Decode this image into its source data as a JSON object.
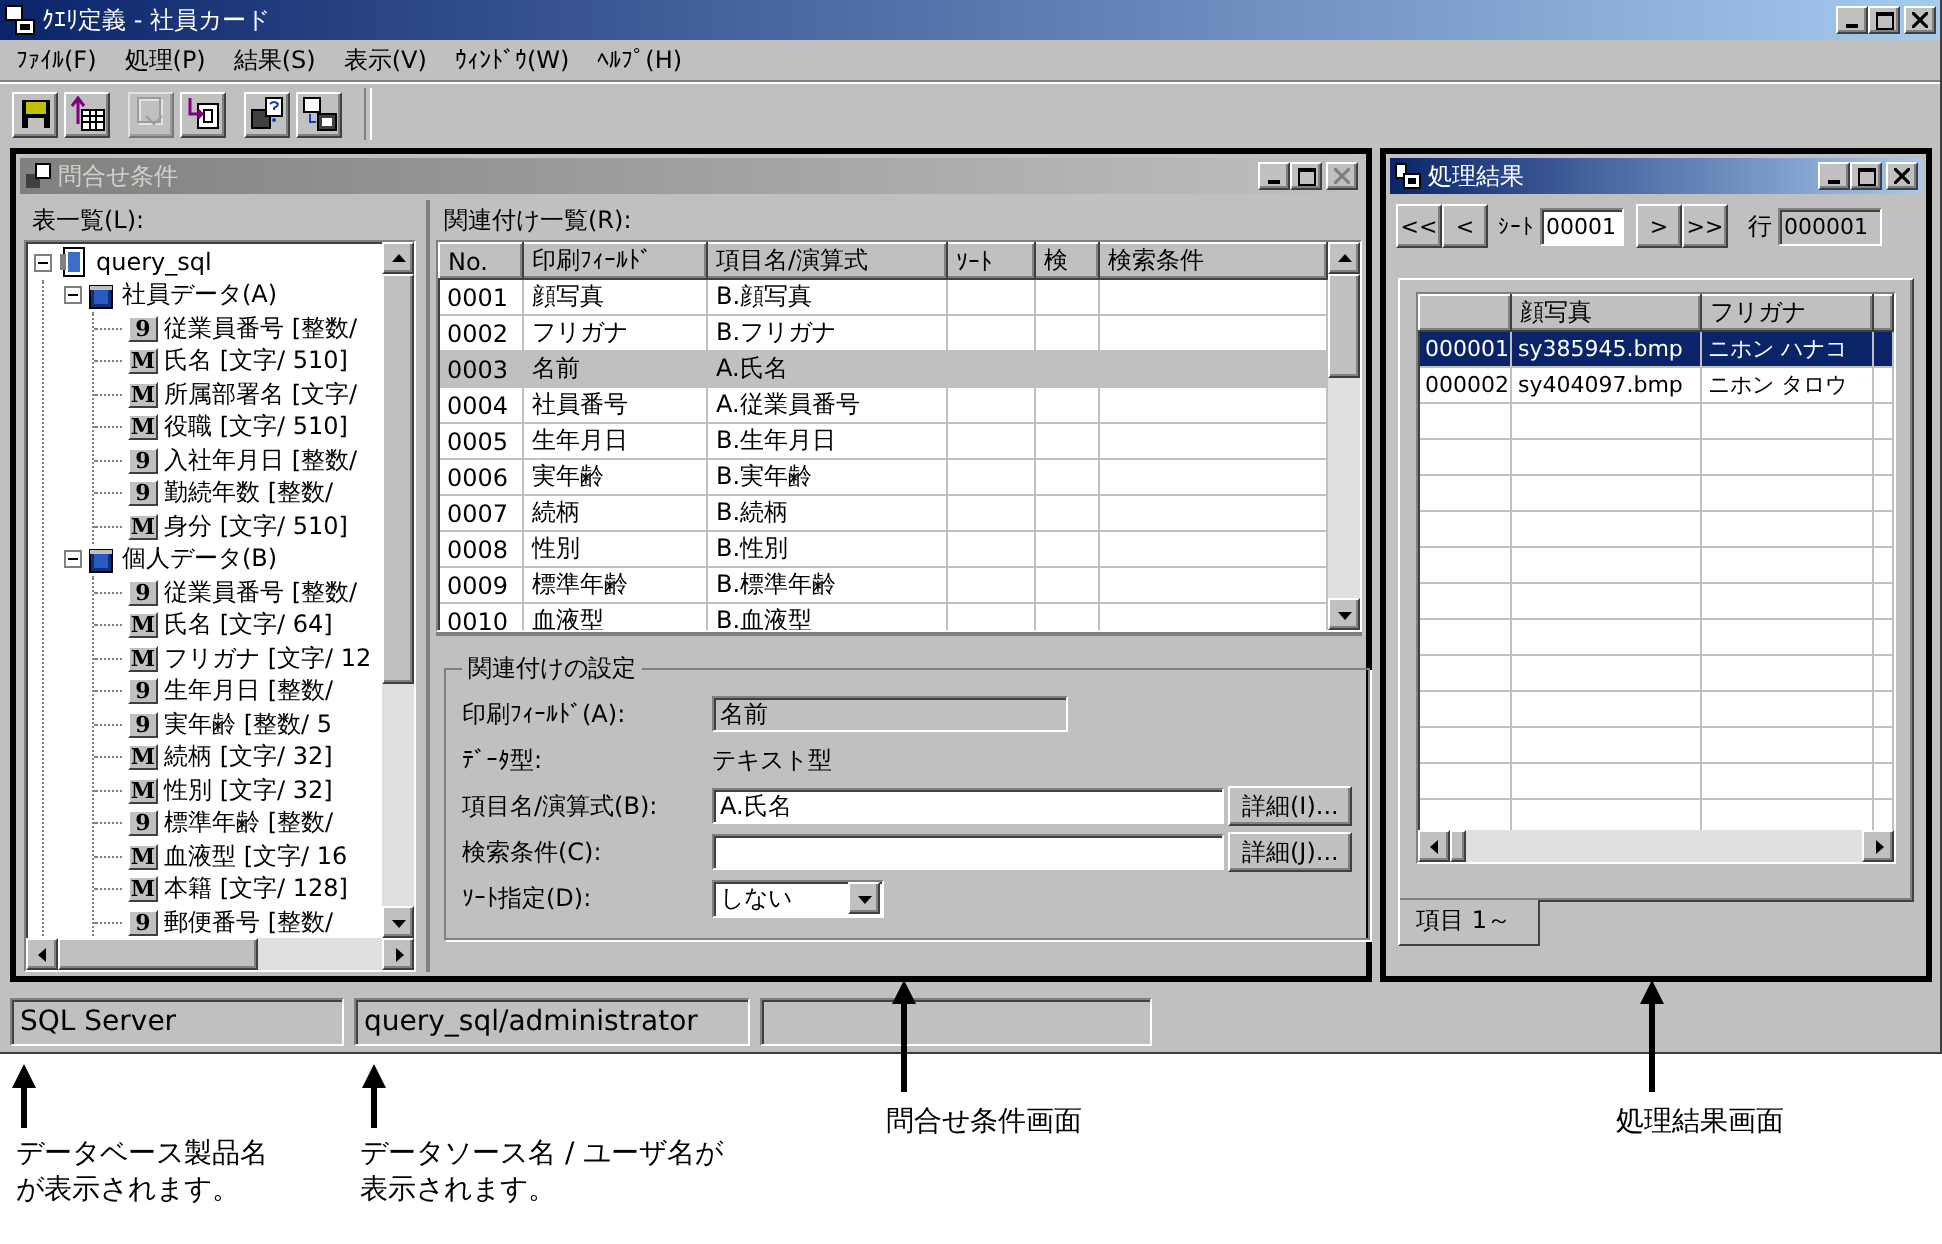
{
  "window": {
    "title": "ｸｴﾘ定義 - 社員カード"
  },
  "menu": [
    {
      "label": "ﾌｧｲﾙ(F)"
    },
    {
      "label": "処理(P)"
    },
    {
      "label": "結果(S)"
    },
    {
      "label": "表示(V)"
    },
    {
      "label": "ｳｨﾝﾄﾞｳ(W)"
    },
    {
      "label": "ﾍﾙﾌﾟ(H)"
    }
  ],
  "toolbar": [
    {
      "kind": "save",
      "disabled": false
    },
    {
      "kind": "table-up",
      "disabled": false
    },
    {
      "kind": "export",
      "disabled": true
    },
    {
      "kind": "insert",
      "disabled": false
    },
    {
      "kind": "query",
      "disabled": false
    },
    {
      "kind": "link",
      "disabled": false
    }
  ],
  "query_window": {
    "title": "問合せ条件",
    "active": false,
    "tables_label": "表一覧(L):",
    "tree": {
      "label": "query_sql",
      "kind": "query",
      "expanded": true,
      "children": [
        {
          "label": "社員データ(A)",
          "kind": "table",
          "expanded": true,
          "children": [
            {
              "label": "従業員番号 [整数/",
              "kind": "field",
              "icon": "9"
            },
            {
              "label": "氏名 [文字/ 510]",
              "kind": "field",
              "icon": "M"
            },
            {
              "label": "所属部署名 [文字/",
              "kind": "field",
              "icon": "M"
            },
            {
              "label": "役職 [文字/ 510]",
              "kind": "field",
              "icon": "M"
            },
            {
              "label": "入社年月日 [整数/",
              "kind": "field",
              "icon": "9"
            },
            {
              "label": "勤続年数 [整数/",
              "kind": "field",
              "icon": "9"
            },
            {
              "label": "身分 [文字/ 510]",
              "kind": "field",
              "icon": "M"
            }
          ]
        },
        {
          "label": "個人データ(B)",
          "kind": "table",
          "expanded": true,
          "children": [
            {
              "label": "従業員番号 [整数/",
              "kind": "field",
              "icon": "9"
            },
            {
              "label": "氏名 [文字/  64]",
              "kind": "field",
              "icon": "M"
            },
            {
              "label": "フリガナ [文字/ 12",
              "kind": "field",
              "icon": "M"
            },
            {
              "label": "生年月日 [整数/",
              "kind": "field",
              "icon": "9"
            },
            {
              "label": "実年齢 [整数/   5",
              "kind": "field",
              "icon": "9"
            },
            {
              "label": "続柄 [文字/  32]",
              "kind": "field",
              "icon": "M"
            },
            {
              "label": "性別 [文字/  32]",
              "kind": "field",
              "icon": "M"
            },
            {
              "label": "標準年齢 [整数/",
              "kind": "field",
              "icon": "9"
            },
            {
              "label": "血液型 [文字/  16",
              "kind": "field",
              "icon": "M"
            },
            {
              "label": "本籍 [文字/ 128]",
              "kind": "field",
              "icon": "M"
            },
            {
              "label": "郵便番号 [整数/",
              "kind": "field",
              "icon": "9"
            }
          ]
        }
      ]
    },
    "relations": {
      "label": "関連付け一覧(R):",
      "columns": [
        "No.",
        "印刷ﾌｨｰﾙﾄﾞ",
        "項目名/演算式",
        "ｿｰﾄ",
        "検",
        "検索条件"
      ],
      "rows": [
        {
          "cells": [
            "0001",
            "顔写真",
            "B.顔写真"
          ],
          "selected": false
        },
        {
          "cells": [
            "0002",
            "フリガナ",
            "B.フリガナ"
          ],
          "selected": false
        },
        {
          "cells": [
            "0003",
            "名前",
            "A.氏名"
          ],
          "selected": true
        },
        {
          "cells": [
            "0004",
            "社員番号",
            "A.従業員番号"
          ],
          "selected": false
        },
        {
          "cells": [
            "0005",
            "生年月日",
            "B.生年月日"
          ],
          "selected": false
        },
        {
          "cells": [
            "0006",
            "実年齢",
            "B.実年齢"
          ],
          "selected": false
        },
        {
          "cells": [
            "0007",
            "続柄",
            "B.続柄"
          ],
          "selected": false
        },
        {
          "cells": [
            "0008",
            "性別",
            "B.性別"
          ],
          "selected": false
        },
        {
          "cells": [
            "0009",
            "標準年齢",
            "B.標準年齢"
          ],
          "selected": false
        },
        {
          "cells": [
            "0010",
            "血液型",
            "B.血液型"
          ],
          "selected": false
        }
      ]
    },
    "settings": {
      "legend": "関連付けの設定",
      "fields": [
        {
          "kind": "readonly",
          "label": "印刷ﾌｨｰﾙﾄﾞ(A):",
          "value": "名前"
        },
        {
          "kind": "static",
          "label": "ﾃﾞｰﾀ型:",
          "value": "テキスト型"
        },
        {
          "kind": "input",
          "label": "項目名/演算式(B):",
          "value": "A.氏名",
          "button": "詳細(I)..."
        },
        {
          "kind": "input",
          "label": "検索条件(C):",
          "button": "詳細(J)..."
        },
        {
          "kind": "select",
          "label": "ｿｰﾄ指定(D):",
          "value": "しない"
        }
      ]
    }
  },
  "result_window": {
    "title": "処理結果",
    "active": true,
    "nav_back": [
      "<<",
      "<"
    ],
    "sheet_label": "ｼｰﾄ",
    "sheet": "00001",
    "nav_forward": [
      ">",
      ">>"
    ],
    "row_label": "行",
    "row": "000001",
    "columns": [
      "顔写真",
      "フリガナ"
    ],
    "rows": [
      {
        "no": "000001",
        "cells": [
          "sy385945.bmp",
          "ニホン ハナコ"
        ],
        "selected": true
      },
      {
        "no": "000002",
        "cells": [
          "sy404097.bmp",
          "ニホン タロウ"
        ],
        "selected": false
      }
    ],
    "tab": "項目 1～"
  },
  "status_bar": [
    "SQL Server",
    "query_sql/administrator"
  ],
  "annotations": [
    {
      "lines": [
        "データベース製品名",
        "が表示されます。"
      ]
    },
    {
      "lines": [
        "データソース名 / ユーザ名が",
        "表示されます。"
      ]
    },
    {
      "lines": [
        "問合せ条件画面"
      ]
    },
    {
      "lines": [
        "処理結果画面"
      ]
    }
  ]
}
